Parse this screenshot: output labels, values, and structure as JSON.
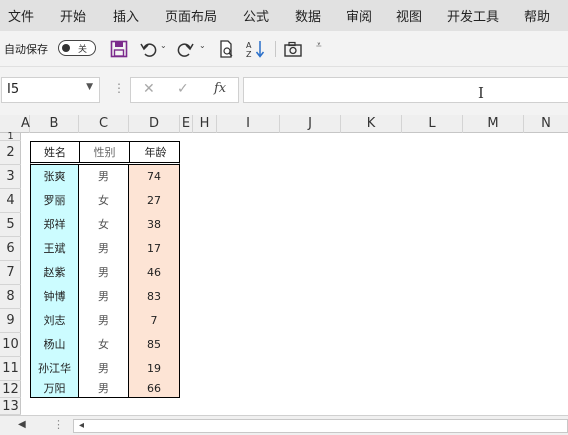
{
  "menu": {
    "items": [
      "文件",
      "开始",
      "插入",
      "页面布局",
      "公式",
      "数据",
      "审阅",
      "视图",
      "开发工具",
      "帮助"
    ]
  },
  "toolbar": {
    "autosave_label": "自动保存",
    "autosave_state": "关",
    "save_icon": "save-icon",
    "undo_icon": "undo-icon",
    "redo_icon": "redo-icon",
    "accent": "#7b2a8c"
  },
  "formula_bar": {
    "cell_ref": "I5",
    "cancel_glyph": "✕",
    "enter_glyph": "✓",
    "fx_label": "fx",
    "value": ""
  },
  "grid": {
    "columns": [
      "A",
      "B",
      "C",
      "D",
      "E",
      "H",
      "I",
      "J",
      "K",
      "L",
      "M",
      "N"
    ],
    "rows": [
      "1",
      "2",
      "3",
      "4",
      "5",
      "6",
      "7",
      "8",
      "9",
      "10",
      "11",
      "12",
      "13"
    ]
  },
  "table": {
    "headers": [
      "姓名",
      "性别",
      "年龄"
    ],
    "rows": [
      {
        "name": "张爽",
        "gender": "男",
        "age": "74"
      },
      {
        "name": "罗丽",
        "gender": "女",
        "age": "27"
      },
      {
        "name": "郑祥",
        "gender": "女",
        "age": "38"
      },
      {
        "name": "王斌",
        "gender": "男",
        "age": "17"
      },
      {
        "name": "赵紫",
        "gender": "男",
        "age": "46"
      },
      {
        "name": "钟博",
        "gender": "男",
        "age": "83"
      },
      {
        "name": "刘志",
        "gender": "男",
        "age": "7"
      },
      {
        "name": "杨山",
        "gender": "女",
        "age": "85"
      },
      {
        "name": "孙江华",
        "gender": "男",
        "age": "19"
      },
      {
        "name": "万阳",
        "gender": "男",
        "age": "66"
      }
    ],
    "colors": {
      "name_fill": "#ccfcff",
      "age_fill": "#fde4d5",
      "border": "#000000"
    }
  }
}
